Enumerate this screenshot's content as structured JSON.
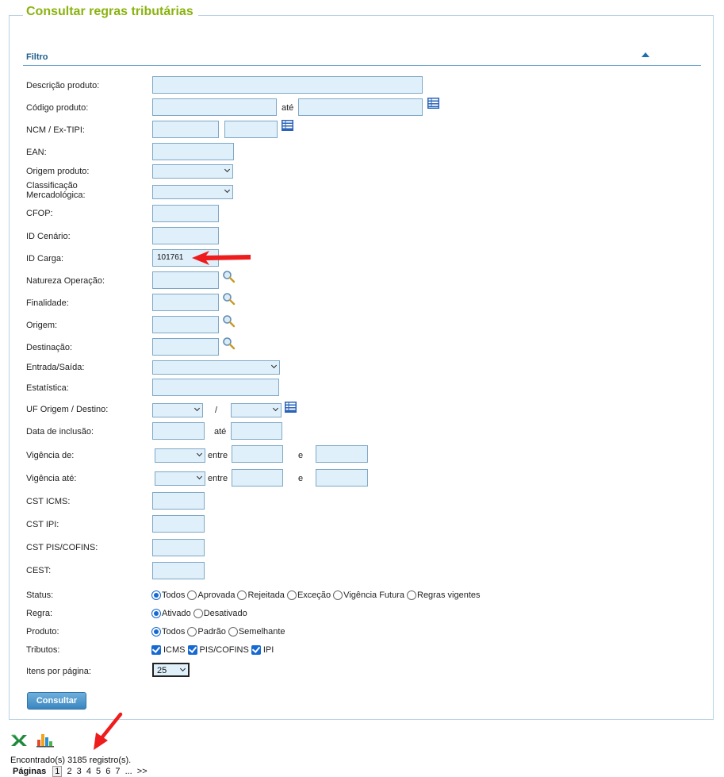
{
  "title": "Consultar regras tributárias",
  "filter_label": "Filtro",
  "labels": {
    "descricao": "Descrição produto:",
    "codigo": "Código produto:",
    "ncm": "NCM / Ex-TIPI:",
    "ean": "EAN:",
    "origem_produto": "Origem produto:",
    "classificacao_1": "Classificação",
    "classificacao_2": "Mercadológica:",
    "cfop": "CFOP:",
    "id_cenario": "ID Cenário:",
    "id_carga": "ID Carga:",
    "natureza": "Natureza Operação:",
    "finalidade": "Finalidade:",
    "origem": "Origem:",
    "destinacao": "Destinação:",
    "entrada_saida": "Entrada/Saída:",
    "estatistica": "Estatística:",
    "uf": "UF Origem / Destino:",
    "data_inclusao": "Data de inclusão:",
    "vigencia_de": "Vigência de:",
    "vigencia_ate": "Vigência até:",
    "cst_icms": "CST ICMS:",
    "cst_ipi": "CST IPI:",
    "cst_pis": "CST PIS/COFINS:",
    "cest": "CEST:",
    "status": "Status:",
    "regra": "Regra:",
    "produto": "Produto:",
    "tributos": "Tributos:",
    "itens": "Itens por página:"
  },
  "words": {
    "ate": "até",
    "slash": "/",
    "entre": "entre",
    "e": "e"
  },
  "values": {
    "id_carga": "101761",
    "itens_por_pagina": "25"
  },
  "status_options": [
    "Todos",
    "Aprovada",
    "Rejeitada",
    "Exceção",
    "Vigência Futura",
    "Regras vigentes"
  ],
  "regra_options": [
    "Ativado",
    "Desativado"
  ],
  "produto_options": [
    "Todos",
    "Padrão",
    "Semelhante"
  ],
  "tributos_options": [
    "ICMS",
    "PIS/COFINS",
    "IPI"
  ],
  "submit_label": "Consultar",
  "result_text": "Encontrado(s) 3185 registro(s).",
  "pages_label": "Páginas",
  "pages": [
    "1",
    "2",
    "3",
    "4",
    "5",
    "6",
    "7",
    "...",
    ">>"
  ],
  "colors": {
    "title": "#8ab30f",
    "input_bg": "#dff0fb",
    "accent": "#1769d2",
    "arrow": "#ee1c1c"
  },
  "icons": [
    "list-icon",
    "search-icon",
    "excel-icon",
    "chart-icon",
    "arrow-icon"
  ]
}
